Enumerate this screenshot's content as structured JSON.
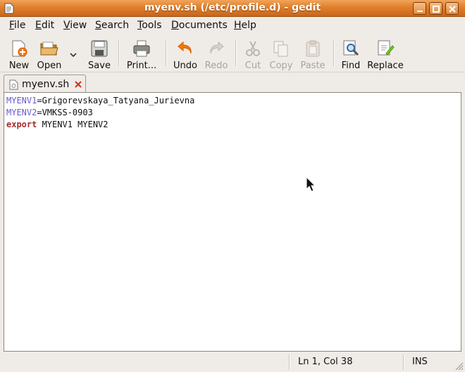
{
  "window": {
    "title": "myenv.sh (/etc/profile.d) - gedit"
  },
  "menu": [
    {
      "label": "File",
      "u": "F",
      "rest": "ile"
    },
    {
      "label": "Edit",
      "u": "E",
      "rest": "dit"
    },
    {
      "label": "View",
      "u": "V",
      "rest": "iew"
    },
    {
      "label": "Search",
      "u": "S",
      "rest": "earch"
    },
    {
      "label": "Tools",
      "u": "T",
      "rest": "ools"
    },
    {
      "label": "Documents",
      "u": "D",
      "rest": "ocuments"
    },
    {
      "label": "Help",
      "u": "H",
      "rest": "elp"
    }
  ],
  "toolbar": {
    "new": "New",
    "open": "Open",
    "save": "Save",
    "print": "Print...",
    "undo": "Undo",
    "redo": "Redo",
    "cut": "Cut",
    "copy": "Copy",
    "paste": "Paste",
    "find": "Find",
    "replace": "Replace"
  },
  "tab": {
    "label": "myenv.sh"
  },
  "editor": {
    "line1_var": "MYENV1",
    "line1_val": "=Grigorevskaya_Tatyana_Jurievna",
    "line2_var": "MYENV2",
    "line2_val": "=VMKSS-0903",
    "line3_kw": "export",
    "line3_rest": " MYENV1 MYENV2"
  },
  "status": {
    "position": "Ln 1, Col 38",
    "mode": "INS"
  },
  "colors": {
    "titlebar": "#e07f2a",
    "variable": "#6a5acd",
    "keyword": "#a52a2a"
  }
}
